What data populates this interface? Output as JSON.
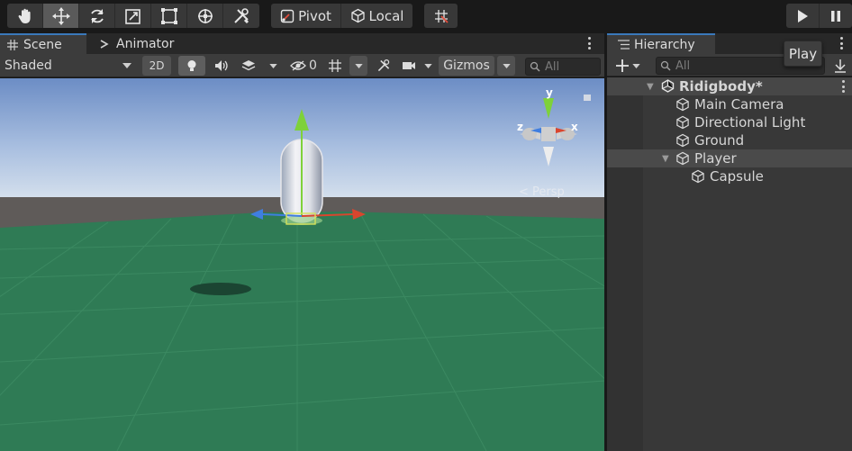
{
  "toolbar": {
    "tools": [
      "hand-tool",
      "move-tool",
      "rotate-tool",
      "scale-tool",
      "rect-tool",
      "transform-tool",
      "custom-tool"
    ],
    "active_tool": "move-tool",
    "pivot_label": "Pivot",
    "local_label": "Local"
  },
  "scene_panel": {
    "tabs": [
      {
        "label": "Scene",
        "icon": "grid-icon",
        "active": true
      },
      {
        "label": "Animator",
        "icon": "animator-icon",
        "active": false
      }
    ],
    "shading_mode": "Shaded",
    "mode_2d_label": "2D",
    "hidden_count": "0",
    "gizmos_label": "Gizmos",
    "search_placeholder": "All",
    "persp_label": "< Persp",
    "axis_labels": {
      "x": "x",
      "y": "y",
      "z": "z"
    }
  },
  "hierarchy": {
    "tab_label": "Hierarchy",
    "search_placeholder": "All",
    "tooltip": "Play",
    "items": [
      {
        "label": "Ridigbody*",
        "depth": 0,
        "type": "scene",
        "expanded": true
      },
      {
        "label": "Main Camera",
        "depth": 1,
        "type": "gameobject"
      },
      {
        "label": "Directional Light",
        "depth": 1,
        "type": "gameobject"
      },
      {
        "label": "Ground",
        "depth": 1,
        "type": "gameobject"
      },
      {
        "label": "Player",
        "depth": 1,
        "type": "gameobject",
        "expanded": true,
        "highlighted": true
      },
      {
        "label": "Capsule",
        "depth": 2,
        "type": "gameobject"
      }
    ]
  },
  "colors": {
    "accent_blue": "#3a79bb",
    "ground_green": "#2f7b55",
    "sky_top": "#6e8fc6",
    "horizon": "#5e5a58",
    "axis_x": "#d9452e",
    "axis_y": "#7ed13a",
    "axis_z": "#3f7ee0"
  }
}
